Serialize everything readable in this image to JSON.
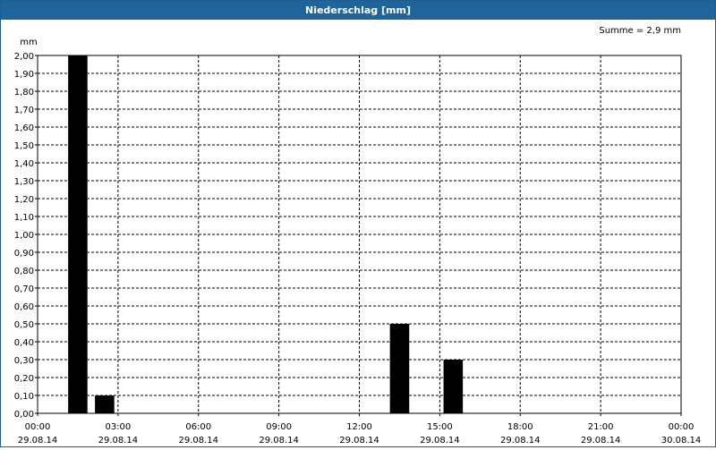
{
  "window": {
    "title": "Niederschlag [mm]"
  },
  "summary": {
    "text": "Summe = 2,9 mm"
  },
  "colors": {
    "titlebar": "#1f649b",
    "bar": "#000000",
    "grid": "#000000"
  },
  "chart_data": {
    "type": "bar",
    "title": "Niederschlag [mm]",
    "ylabel": "mm",
    "xlabel": "",
    "ylim": [
      0,
      2
    ],
    "y_ticks": [
      "0,00",
      "0,10",
      "0,20",
      "0,30",
      "0,40",
      "0,50",
      "0,60",
      "0,70",
      "0,80",
      "0,90",
      "1,00",
      "1,10",
      "1,20",
      "1,30",
      "1,40",
      "1,50",
      "1,60",
      "1,70",
      "1,80",
      "1,90",
      "2,00"
    ],
    "x_range_hours": [
      0,
      24
    ],
    "x_ticks": [
      {
        "time": "00:00",
        "date": "29.08.14"
      },
      {
        "time": "03:00",
        "date": "29.08.14"
      },
      {
        "time": "06:00",
        "date": "29.08.14"
      },
      {
        "time": "09:00",
        "date": "29.08.14"
      },
      {
        "time": "12:00",
        "date": "29.08.14"
      },
      {
        "time": "15:00",
        "date": "29.08.14"
      },
      {
        "time": "18:00",
        "date": "29.08.14"
      },
      {
        "time": "21:00",
        "date": "29.08.14"
      },
      {
        "time": "00:00",
        "date": "30.08.14"
      }
    ],
    "bars": [
      {
        "time": "01:00-02:00",
        "start_hour": 1,
        "end_hour": 2,
        "value": 2.0
      },
      {
        "time": "02:00-03:00",
        "start_hour": 2,
        "end_hour": 3,
        "value": 0.1
      },
      {
        "time": "13:00-14:00",
        "start_hour": 13,
        "end_hour": 14,
        "value": 0.5
      },
      {
        "time": "15:00-16:00",
        "start_hour": 15,
        "end_hour": 16,
        "value": 0.3
      }
    ],
    "grid": true,
    "total": "2,9 mm"
  }
}
